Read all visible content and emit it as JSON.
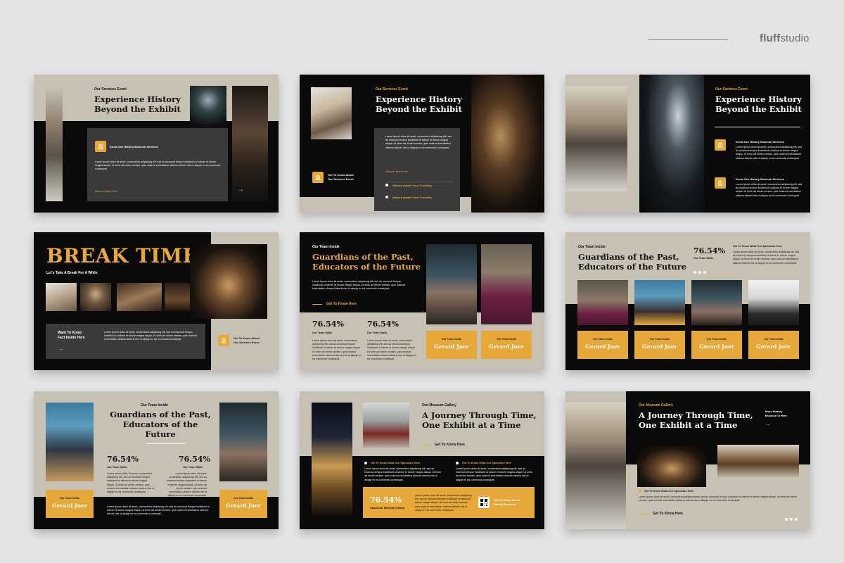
{
  "brand": {
    "name_bold": "fluff",
    "name_light": "studio"
  },
  "colors": {
    "gold": "#e7a83a",
    "beige": "#c7c1b3",
    "black": "#0a0a0a",
    "dark": "#3a3a3a"
  },
  "lorem_short": "Lorem ipsum dolor sit amet, consectetur adipiscing elit, sed do eiusmod tempor incididunt ut labore et dolore magna aliqua. Ut enim ad minim veniam, quis nostrud exercitation ullamco laboris nisi ut aliquip ex ea commodo consequat.",
  "lorem_long": "Lorem ipsum dolor sit amet, consectetur adipiscing elit, sed do eiusmod tempor incididunt ut labore et dolore magna aliqua. Ut enim ad minim veniam, quis nostrud exercitation ullamco laboris nisi ut aliquip ex ea commodo consequat. Duis aute irure dolor in reprehenderit in voluptate velit esse cillum dolore eu fugiat nulla pariatur. Excepteur sint occaecat cupidatat non proident.",
  "s1": {
    "eyebrow": "Our Services Event",
    "title1": "Experience History",
    "title2": "Beyond the Exhibit",
    "card_label": "Know Our History Museum Services",
    "link": "Discover More Here",
    "icon": "museum-icon"
  },
  "s2": {
    "eyebrow": "Our Services Event",
    "title1": "Experience History",
    "title2": "Beyond the Exhibit",
    "link": "Discover More Here",
    "item1": "History Awaits Your Curiosity",
    "item2": "History Awaits Your Curiosity",
    "cta1": "Get To Know About",
    "cta2": "Our Services Event"
  },
  "s3": {
    "eyebrow": "Our Services Event",
    "title1": "Experience History",
    "title2": "Beyond the Exhibit",
    "item1": "Know Our History Museum Services",
    "item2": "Know Our History Museum Services"
  },
  "s4": {
    "title": "BREAK TIME",
    "subtitle": "Let's Take A Break For A While",
    "box1": "Want To Know",
    "box2": "Fact Inside Here",
    "cta1": "Get To Know About",
    "cta2": "Our Services Event"
  },
  "s5": {
    "eyebrow": "Our Team Inside",
    "title1": "Guardians of the Past,",
    "title2": "Educators of the Future",
    "link": "Get To Know Here",
    "pct1": "76.54%",
    "skill1": "Our Team Skills",
    "pct2": "76.54%",
    "skill2": "Our Team Skills",
    "card_sub": "Our Team Inside",
    "name1": "Gerard Juer",
    "name2": "Gerard Juer"
  },
  "s6": {
    "eyebrow": "Our Team Inside",
    "title1": "Guardians of the Past,",
    "title2": "Educators of the Future",
    "pct": "76.54%",
    "skill": "Our Team Skills",
    "link": "Get To Know What Our Specialize Here",
    "card_sub": "Our Team Inside",
    "names": [
      "Gerard Juer",
      "Gerard Juer",
      "Gerard Juer",
      "Gerard Juer"
    ]
  },
  "s7": {
    "eyebrow": "Our Team Inside",
    "title1": "Guardians of the Past,",
    "title2": "Educators of the Future",
    "pct1": "76.54%",
    "skill1": "Our Team Skills",
    "pct2": "76.54%",
    "skill2": "Our Team Skills",
    "card_sub": "Our Team Inside",
    "name1": "Gerard Juer",
    "name2": "Gerard Juer"
  },
  "s8": {
    "eyebrow": "Our Museum Gallery",
    "title1": "A Journey Through Time,",
    "title2": "One Exhibit at a Time",
    "link": "Get To Know Here",
    "col1": "Get To Know What Our Specialize Here",
    "col2": "Get To Know What Our Specialize Here",
    "pct": "76.54%",
    "pct_label": "About Our Museum Gallery",
    "cta1": "Get To Know About",
    "cta2": "History Museum"
  },
  "s9": {
    "eyebrow": "Our Museum Gallery",
    "title1": "A Journey Through Time,",
    "title2": "One Exhibit at a Time",
    "more1": "More History",
    "more2": "Museum In Here",
    "item": "Get To Know What Our Specialize Here",
    "link": "Get To Know Here"
  }
}
